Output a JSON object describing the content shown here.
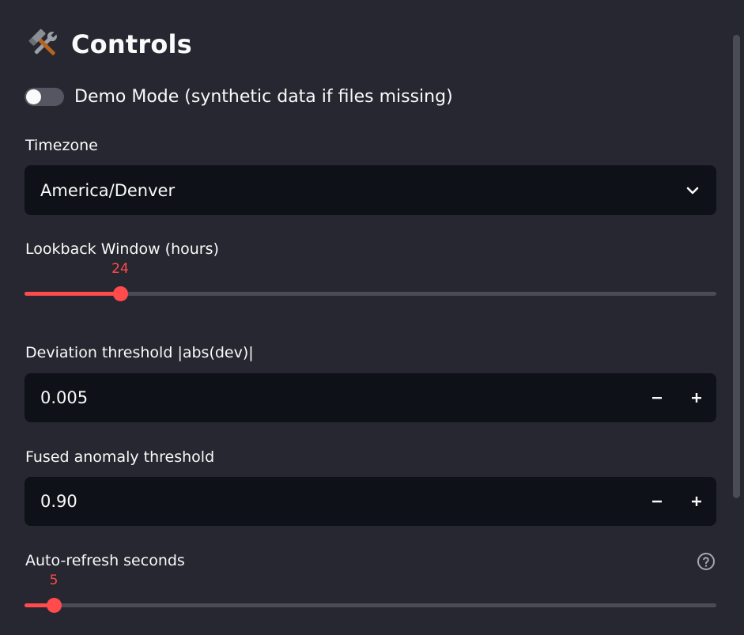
{
  "header": {
    "icon": "hammer-wrench-icon",
    "title": "Controls"
  },
  "demo_mode": {
    "label": "Demo Mode (synthetic data if files missing)",
    "enabled": false
  },
  "timezone": {
    "label": "Timezone",
    "value": "America/Denver",
    "icon": "chevron-down-icon"
  },
  "lookback": {
    "label": "Lookback Window (hours)",
    "value": "24",
    "fraction": 0.138
  },
  "deviation": {
    "label": "Deviation threshold |abs(dev)|",
    "value": "0.005",
    "decrement": "−",
    "increment": "+"
  },
  "fused": {
    "label": "Fused anomaly threshold",
    "value": "0.90",
    "decrement": "−",
    "increment": "+"
  },
  "autorefresh": {
    "label": "Auto-refresh seconds",
    "value": "5",
    "fraction": 0.042,
    "help_icon": "question-circle-icon"
  },
  "colors": {
    "background": "#262730",
    "input_background": "#0e1117",
    "accent": "#ff4b4b",
    "text": "#fafafa"
  }
}
